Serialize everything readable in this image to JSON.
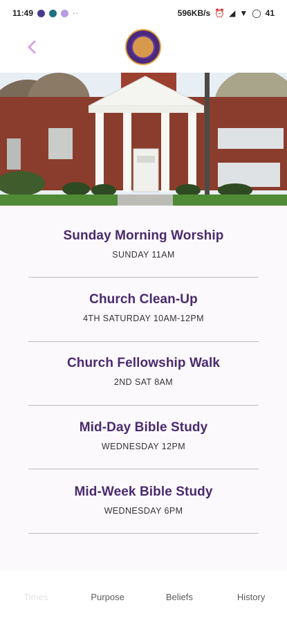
{
  "status_bar": {
    "time": "11:49",
    "dots_label": "··",
    "network_speed": "596KB/s",
    "battery": "41"
  },
  "header": {
    "back_icon": "chevron-left-icon",
    "logo": "church-seal-logo"
  },
  "services": [
    {
      "title": "Sunday Morning Worship",
      "time": "SUNDAY 11AM"
    },
    {
      "title": "Church Clean-Up",
      "time": "4TH SATURDAY 10AM-12PM"
    },
    {
      "title": "Church Fellowship Walk",
      "time": "2ND SAT 8AM"
    },
    {
      "title": "Mid-Day Bible Study",
      "time": "WEDNESDAY 12PM"
    },
    {
      "title": "Mid-Week Bible Study",
      "time": "WEDNESDAY 6PM"
    }
  ],
  "nav": {
    "tabs": [
      {
        "label": "Times"
      },
      {
        "label": "Purpose"
      },
      {
        "label": "Beliefs"
      },
      {
        "label": "History"
      }
    ]
  },
  "colors": {
    "accent": "#4a2a6e",
    "back": "#d9a2e6",
    "logo_ring": "#e0a23a"
  }
}
